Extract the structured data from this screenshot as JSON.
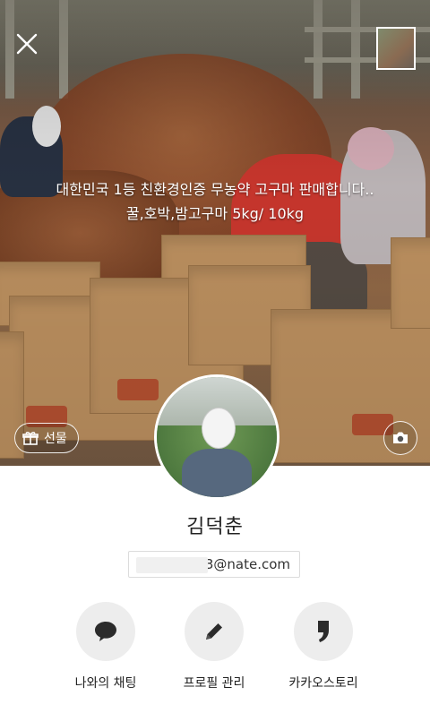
{
  "cover": {
    "status_message": "대한민국 1등 친환경인증 무농약 고구마 판매합니다..  꿀,호박,밤고구마 5kg/ 10kg",
    "gift_label": "선물",
    "box_print": "고구마"
  },
  "profile": {
    "name": "김덕춘",
    "email_visible": "3@nate.com"
  },
  "actions": [
    {
      "label": "나와의 채팅",
      "icon": "chat-bubble-icon"
    },
    {
      "label": "프로필 관리",
      "icon": "pencil-icon"
    },
    {
      "label": "카카오스토리",
      "icon": "kakaostory-icon"
    }
  ],
  "colors": {
    "action_circle": "#ededed",
    "icon": "#2b2b2b",
    "text": "#222222"
  }
}
